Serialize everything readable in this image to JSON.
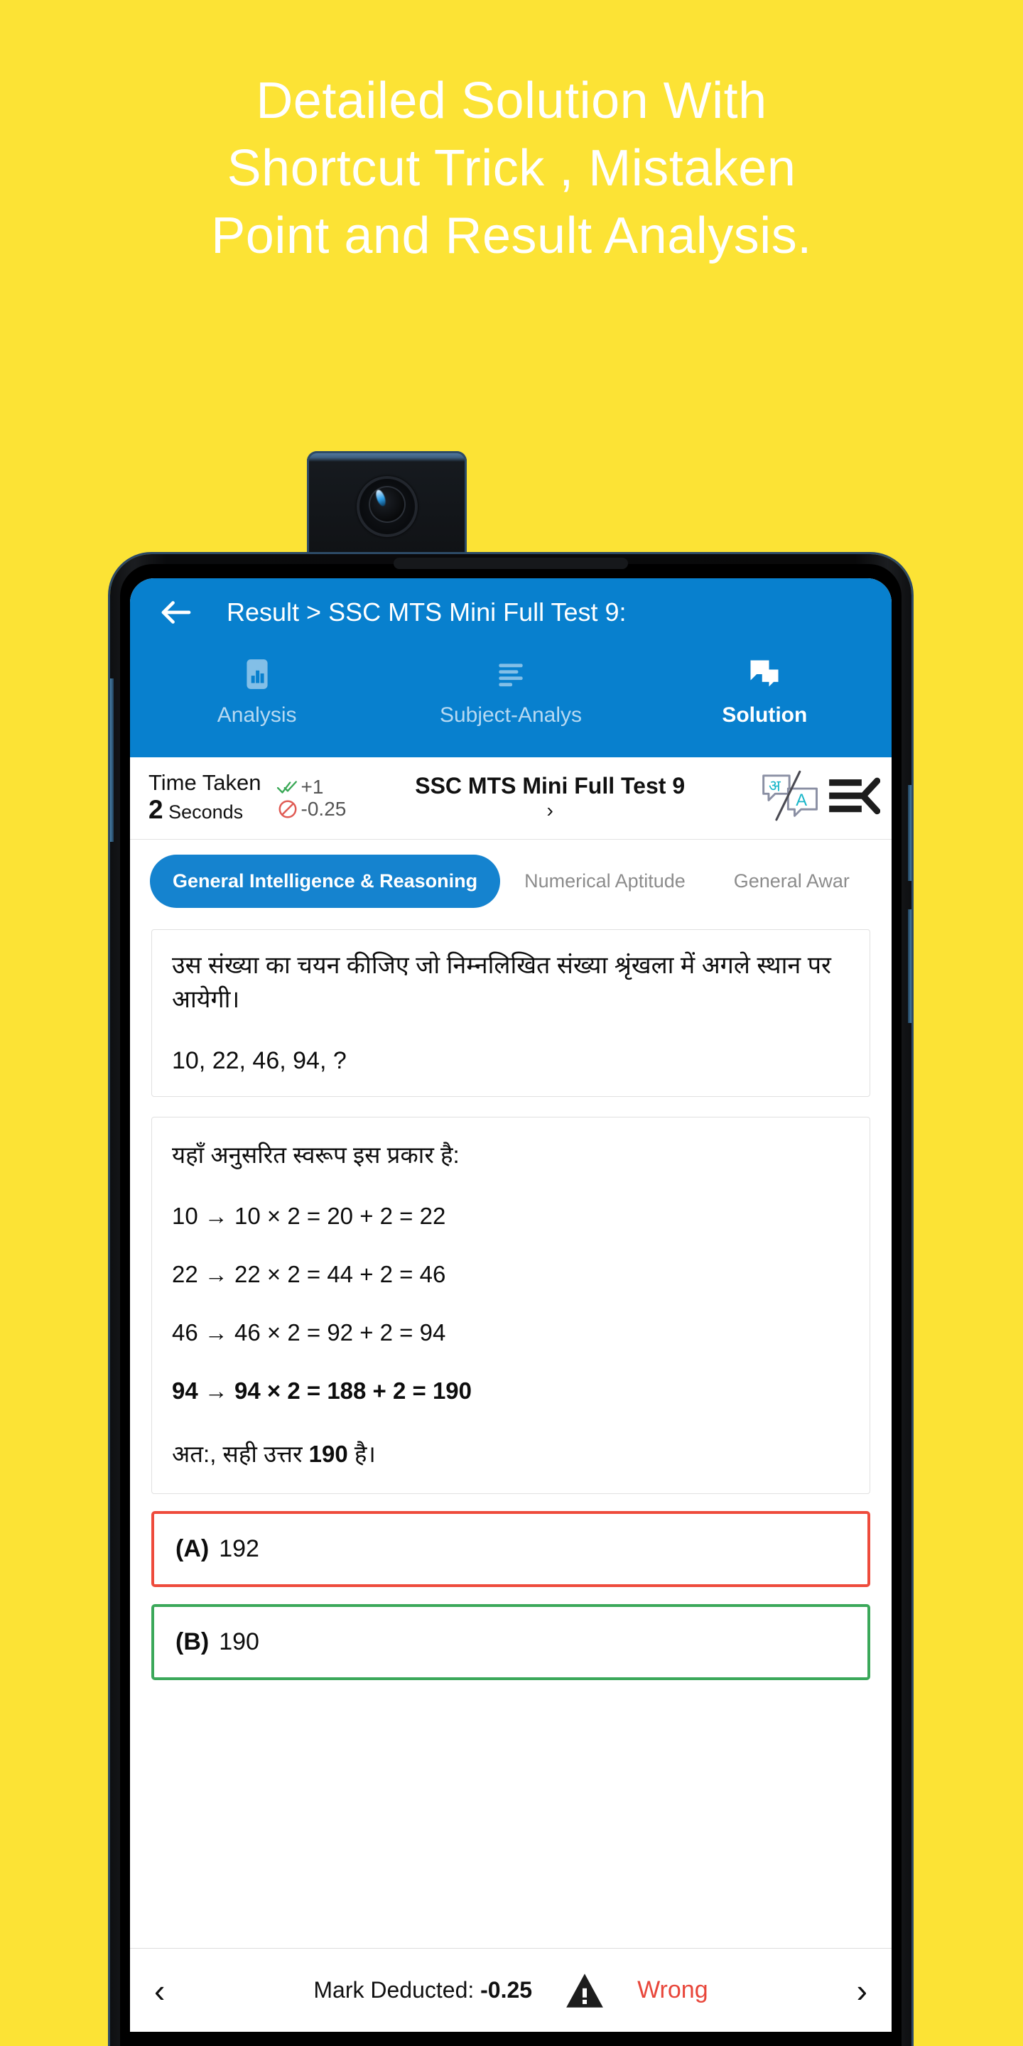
{
  "promo": {
    "headline_lines": [
      "Detailed Solution With",
      "Shortcut Trick , Mistaken",
      "Point and Result Analysis."
    ],
    "background_color": "#FCE335",
    "headline_color": "#FFFFFF"
  },
  "app": {
    "accent_blue": "#0880CE",
    "appbar": {
      "back_icon": "back-arrow-icon",
      "title": "Result > SSC MTS Mini Full Test 9:"
    },
    "tabs": [
      {
        "label": "Analysis",
        "icon": "bar-chart-icon",
        "active": false
      },
      {
        "label": "Subject-Analys",
        "icon": "list-lines-icon",
        "active": false
      },
      {
        "label": "Solution",
        "icon": "chat-bubbles-icon",
        "active": true
      }
    ],
    "infobar": {
      "time_label": "Time Taken",
      "time_value_number": "2",
      "time_value_unit": "Seconds",
      "positive_mark": "+1",
      "positive_icon": "double-check-icon",
      "positive_color": "#3AA856",
      "negative_mark": "-0.25",
      "negative_icon": "ban-circle-icon",
      "negative_color": "#E05B54",
      "test_name": "SSC MTS Mini Full Test 9",
      "test_chevron": "›",
      "translate_icon": "translate-icon",
      "translate_glyph_left": "अ",
      "translate_glyph_right": "A",
      "menu_icon": "menu-collapse-icon"
    },
    "subject_chips": [
      {
        "label": "General Intelligence & Reasoning",
        "active": true
      },
      {
        "label": "Numerical Aptitude",
        "active": false
      },
      {
        "label": "General Awar",
        "active": false
      }
    ],
    "question": {
      "text": "उस संख्या का चयन कीजिए जो निम्नलिखित संख्या श्रृंखला में अगले स्थान पर आयेगी।",
      "series": "10, 22, 46, 94, ?"
    },
    "solution": {
      "intro": "यहाँ अनुसरित स्वरूप इस प्रकार है:",
      "steps": [
        {
          "text": "10 → 10 × 2 = 20 + 2 = 22",
          "bold": false
        },
        {
          "text": "22 → 22 × 2 = 44 + 2 = 46",
          "bold": false
        },
        {
          "text": "46 → 46 × 2 = 92 + 2 = 94",
          "bold": false
        },
        {
          "text": "94 → 94 × 2 = 188 + 2 = 190",
          "bold": true
        }
      ],
      "conclusion_prefix": "अत:, सही उत्तर ",
      "conclusion_answer": "190",
      "conclusion_suffix": " है।"
    },
    "options": [
      {
        "key": "(A)",
        "value": "192",
        "state": "wrong",
        "border_color": "#EE4B3C"
      },
      {
        "key": "(B)",
        "value": "190",
        "state": "correct",
        "border_color": "#3BA85A"
      }
    ],
    "bottombar": {
      "prev_icon": "chevron-left-icon",
      "mark_label": "Mark Deducted: ",
      "mark_value": "-0.25",
      "status_icon": "warning-triangle-icon",
      "status_text": "Wrong",
      "status_color": "#E8463A",
      "next_icon": "chevron-right-icon"
    }
  }
}
